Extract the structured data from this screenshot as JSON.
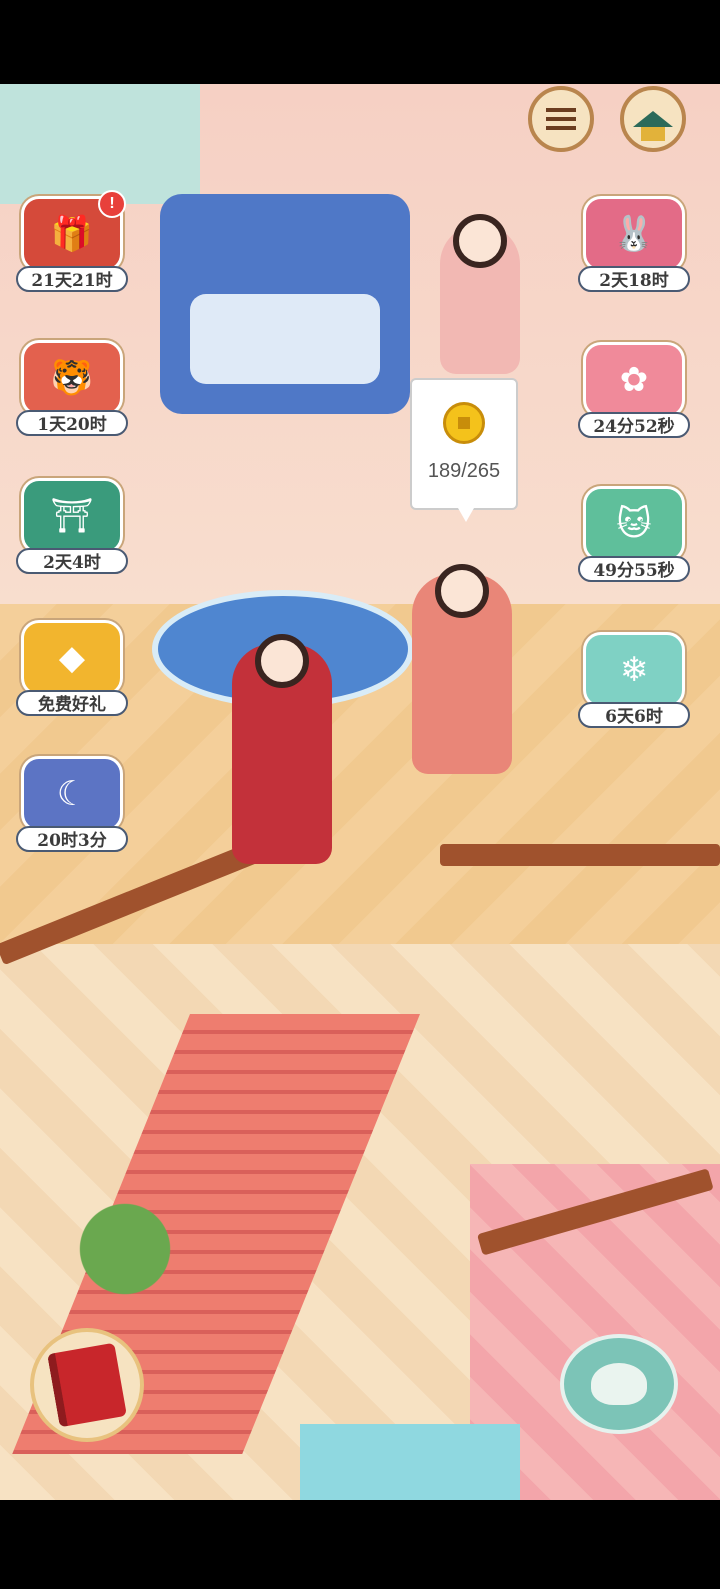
{
  "colors": {
    "label_border": "#4a5a73",
    "coin_gold": "#f4c21b",
    "notification_red": "#e8403b"
  },
  "top_buttons": [
    {
      "icon": "menu-list-icon"
    },
    {
      "icon": "pavilion-shop-icon"
    }
  ],
  "events_left": [
    {
      "icon": "gift-box-icon",
      "timer": "21天21时",
      "badge": "!"
    },
    {
      "icon": "tiger-mask-icon",
      "timer": "1天20时"
    },
    {
      "icon": "gate-treasure-icon",
      "timer": "2天4时"
    },
    {
      "icon": "kite-icon",
      "timer": "免费好礼"
    },
    {
      "icon": "rabbit-moon-icon",
      "timer": "20时3分"
    }
  ],
  "events_right": [
    {
      "icon": "rabbit-icon",
      "timer": "2天18时"
    },
    {
      "icon": "flower-cushion-icon",
      "timer": "24分52秒"
    },
    {
      "icon": "lucky-cat-icon",
      "timer": "49分55秒"
    },
    {
      "icon": "ice-cube-icon",
      "timer": "6天6时"
    }
  ],
  "coin_bubble": {
    "icon": "copper-coin-icon",
    "count": "189/265"
  },
  "bottom_buttons": [
    {
      "icon": "book-icon"
    },
    {
      "icon": "teapot-icon"
    }
  ]
}
